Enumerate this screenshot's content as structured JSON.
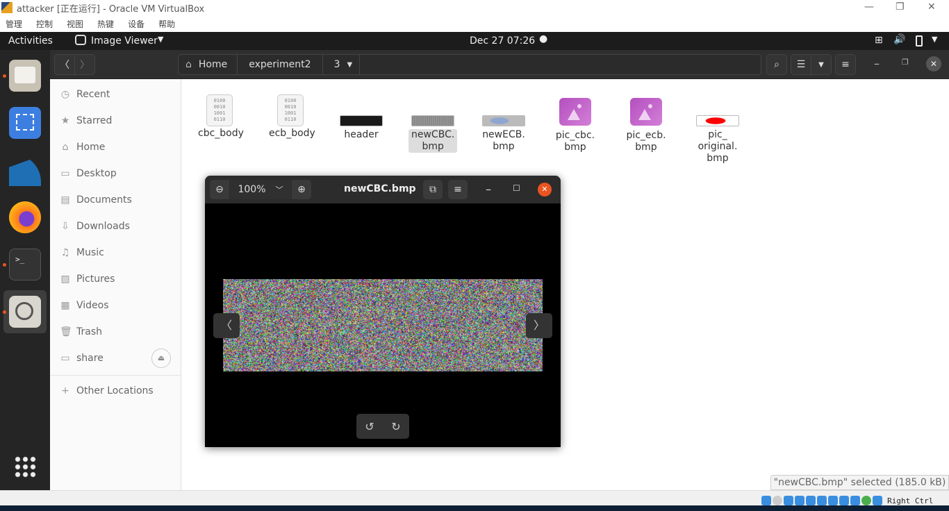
{
  "vbox": {
    "title": "attacker [正在运行] - Oracle VM VirtualBox",
    "menu": [
      "管理",
      "控制",
      "视图",
      "热键",
      "设备",
      "帮助"
    ],
    "host_key": "Right Ctrl"
  },
  "topbar": {
    "activities": "Activities",
    "app": "Image Viewer",
    "clock": "Dec 27  07:26"
  },
  "nautilus": {
    "breadcrumb": [
      "Home",
      "experiment2",
      "3"
    ],
    "sidebar": [
      {
        "label": "Recent",
        "icon": "clock-icon",
        "glyph": "◷"
      },
      {
        "label": "Starred",
        "icon": "star-icon",
        "glyph": "★"
      },
      {
        "label": "Home",
        "icon": "home-icon",
        "glyph": "⌂"
      },
      {
        "label": "Desktop",
        "icon": "desktop-icon",
        "glyph": "▭"
      },
      {
        "label": "Documents",
        "icon": "document-icon",
        "glyph": "▤"
      },
      {
        "label": "Downloads",
        "icon": "download-icon",
        "glyph": "⇩"
      },
      {
        "label": "Music",
        "icon": "music-icon",
        "glyph": "♫"
      },
      {
        "label": "Pictures",
        "icon": "picture-icon",
        "glyph": "▨"
      },
      {
        "label": "Videos",
        "icon": "video-icon",
        "glyph": "▦"
      },
      {
        "label": "Trash",
        "icon": "trash-icon",
        "glyph": "🗑"
      },
      {
        "label": "share",
        "icon": "drive-icon",
        "glyph": "▭"
      }
    ],
    "other_locations": "Other Locations",
    "files": [
      {
        "name": "cbc_body",
        "kind": "binary"
      },
      {
        "name": "ecb_body",
        "kind": "binary"
      },
      {
        "name": "header",
        "kind": "thumb-black"
      },
      {
        "name": "newCBC.\nbmp",
        "kind": "thumb-noise",
        "selected": true
      },
      {
        "name": "newECB.\nbmp",
        "kind": "thumb-ecb"
      },
      {
        "name": "pic_cbc.\nbmp",
        "kind": "image"
      },
      {
        "name": "pic_ecb.\nbmp",
        "kind": "image"
      },
      {
        "name": "pic_\noriginal.\nbmp",
        "kind": "thumb-original"
      }
    ],
    "status": "\"newCBC.bmp\" selected  (185.0 kB)"
  },
  "viewer": {
    "title": "newCBC.bmp",
    "zoom": "100%"
  },
  "colors": {
    "accent": "#e95420",
    "topbar": "#1c1c1c",
    "dock": "#252525"
  }
}
